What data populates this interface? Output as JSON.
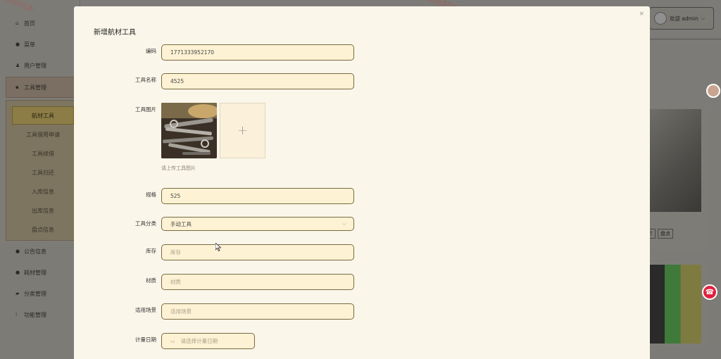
{
  "sidebar": {
    "items": [
      {
        "label": "首页",
        "icon": "home-icon"
      },
      {
        "label": "菜单",
        "icon": "menu-icon"
      },
      {
        "label": "用户管理",
        "icon": "user-icon"
      },
      {
        "label": "工具管理",
        "icon": "grid-icon"
      },
      {
        "label": "公告信息",
        "icon": "dot-icon"
      },
      {
        "label": "耗材管理",
        "icon": "dot-icon"
      },
      {
        "label": "分类管理",
        "icon": "folder-icon"
      },
      {
        "label": "功能管理",
        "icon": "grid-icon"
      }
    ],
    "submenu": [
      "航材工具",
      "工具借用申请",
      "工具续借",
      "工具归还",
      "入库信息",
      "出库信息",
      "盘点信息"
    ],
    "active_sub": "航材工具"
  },
  "header": {
    "user_label": "欢迎 admin"
  },
  "cards": {
    "tag1": "盘点",
    "tag0": "丌"
  },
  "watermarks": [
    "源码好优多",
    "源码好优多",
    "源码好优多"
  ],
  "modal": {
    "title": "新增航材工具",
    "close": "×",
    "fields": {
      "code": {
        "label": "编码",
        "value": "1771333952170"
      },
      "name": {
        "label": "工具名称",
        "value": "4525"
      },
      "image": {
        "label": "工具图片",
        "tip": "请上传工具图片",
        "add": "+"
      },
      "spec": {
        "label": "规格",
        "value": "525"
      },
      "category": {
        "label": "工具分类",
        "value": "手动工具"
      },
      "stock": {
        "label": "库存",
        "placeholder": "库存"
      },
      "material": {
        "label": "材质",
        "placeholder": "材质"
      },
      "scene": {
        "label": "适用场景",
        "placeholder": "适用场景"
      },
      "date": {
        "label": "计量日期",
        "placeholder": "请选择计量日期"
      }
    }
  },
  "colors": {
    "accent": "#7a6a42",
    "input_bg": "#fdf2d3",
    "modal_bg": "#faf6ea",
    "fab": "#e0223f"
  }
}
